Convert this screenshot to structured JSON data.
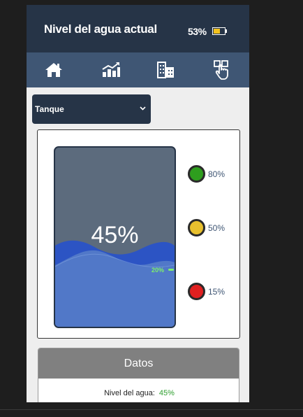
{
  "header": {
    "title": "Nivel del agua actual",
    "battery": "53%"
  },
  "nav": {
    "items": [
      {
        "icon": "home-icon"
      },
      {
        "icon": "chart-icon"
      },
      {
        "icon": "buildings-icon"
      },
      {
        "icon": "touch-icon"
      }
    ]
  },
  "selector": {
    "value": "Tanque"
  },
  "tank": {
    "level_text": "45%",
    "level": 45,
    "min_label": "20%"
  },
  "indicators": [
    {
      "label": "80%",
      "color": "#2e9e1e"
    },
    {
      "label": "50%",
      "color": "#e8c02e"
    },
    {
      "label": "15%",
      "color": "#e02020"
    }
  ],
  "datos": {
    "title": "Datos",
    "row_label": "Nivel del agua:",
    "row_value": "45%"
  },
  "colors": {
    "header": "#263447",
    "nav": "#3f5674",
    "water": "#5178c8",
    "min_marker": "#7ef06b"
  }
}
